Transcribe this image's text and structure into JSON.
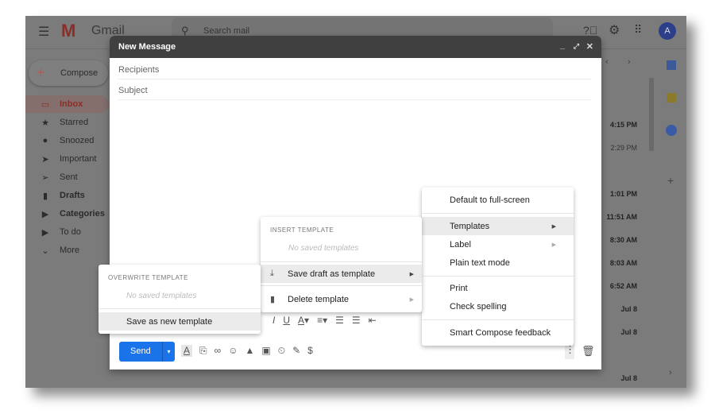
{
  "app": {
    "logo_text": "Gmail",
    "search_placeholder": "Search mail",
    "avatar": "A"
  },
  "sidebar": {
    "compose": "Compose",
    "items": [
      {
        "label": "Inbox",
        "icon": "inbox-icon",
        "glyph": "▭"
      },
      {
        "label": "Starred",
        "icon": "star-icon",
        "glyph": "★"
      },
      {
        "label": "Snoozed",
        "icon": "clock-icon",
        "glyph": "●"
      },
      {
        "label": "Important",
        "icon": "important-icon",
        "glyph": "➤"
      },
      {
        "label": "Sent",
        "icon": "send-icon",
        "glyph": "➢"
      },
      {
        "label": "Drafts",
        "icon": "draft-icon",
        "glyph": "▮"
      },
      {
        "label": "Categories",
        "icon": "label-icon",
        "glyph": "▶"
      },
      {
        "label": "To do",
        "icon": "label-icon",
        "glyph": "▶"
      },
      {
        "label": "More",
        "icon": "chevron-down-icon",
        "glyph": "⌄"
      }
    ]
  },
  "mail_times": [
    "4:15 PM",
    "2:29 PM",
    "1:01 PM",
    "11:51 AM",
    "8:30 AM",
    "8:03 AM",
    "6:52 AM",
    "Jul 8",
    "Jul 8",
    "Jul 8"
  ],
  "compose": {
    "title": "New Message",
    "recipients_placeholder": "Recipients",
    "subject_placeholder": "Subject",
    "send": "Send"
  },
  "more_menu": {
    "items": [
      "Default to full-screen",
      "Templates",
      "Label",
      "Plain text mode",
      "Print",
      "Check spelling",
      "Smart Compose feedback"
    ]
  },
  "templates_menu": {
    "header": "INSERT TEMPLATE",
    "empty": "No saved templates",
    "save": "Save draft as template",
    "delete": "Delete template"
  },
  "overwrite_menu": {
    "header": "OVERWRITE TEMPLATE",
    "empty": "No saved templates",
    "save_new": "Save as new template"
  },
  "colors": {
    "send": "#1a73e8",
    "compose_header": "#404040",
    "inbox": "#b3261e"
  }
}
